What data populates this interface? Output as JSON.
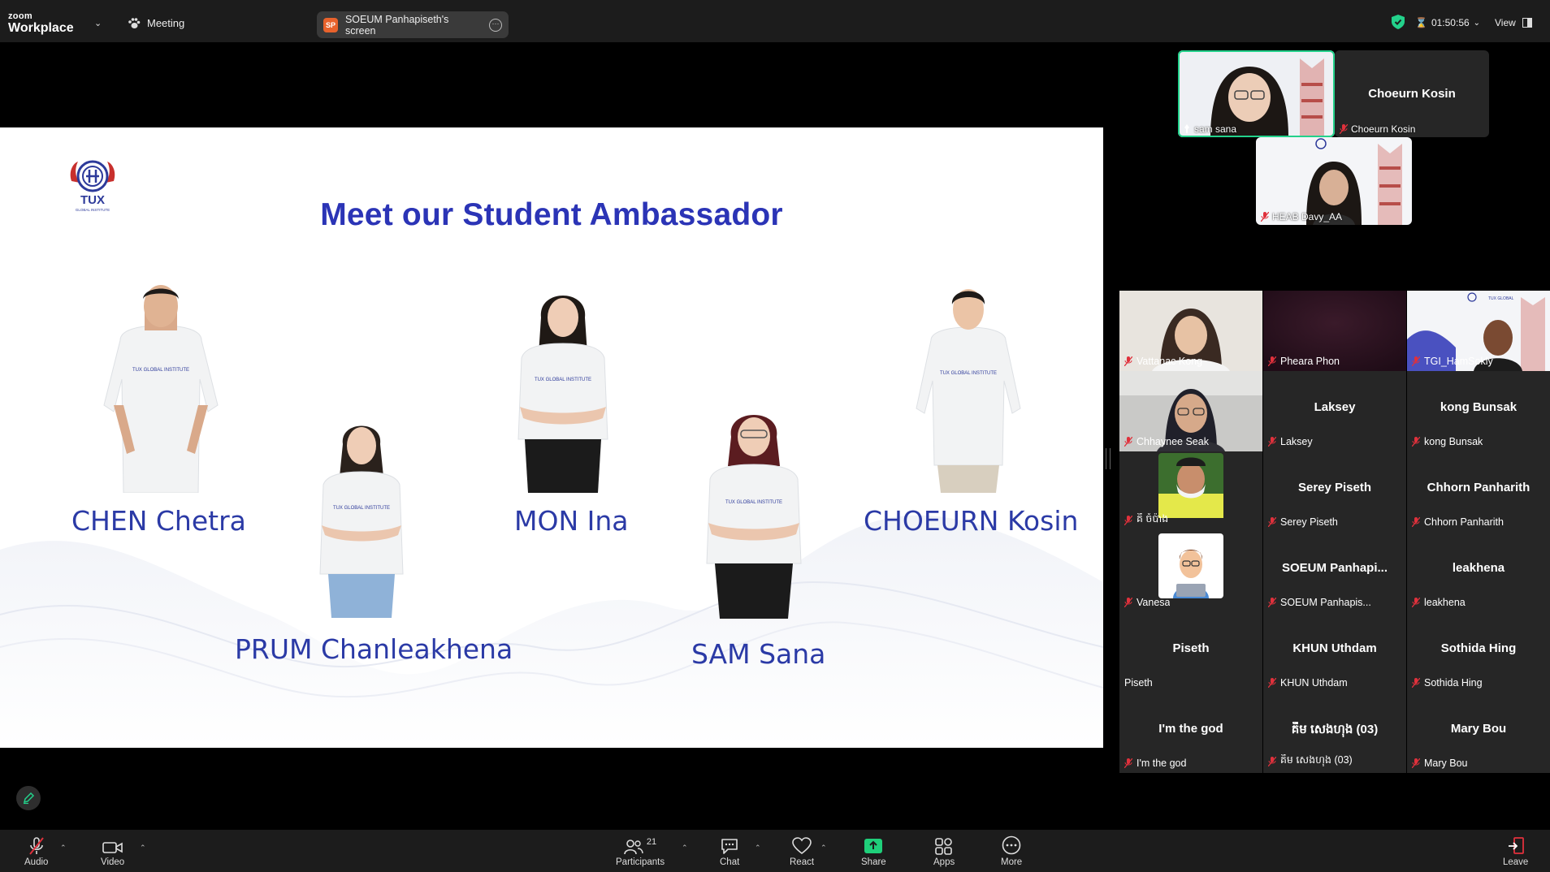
{
  "app": {
    "brand_small": "zoom",
    "brand_big": "Workplace",
    "meeting_label": "Meeting"
  },
  "share": {
    "badge": "SP",
    "label": "SOEUM Panhapiseth's screen"
  },
  "status": {
    "timer": "01:50:56",
    "view_label": "View"
  },
  "slide": {
    "logo_text": "TUX",
    "logo_sub": "GLOBAL INSTITUTE",
    "title": "Meet our Student Ambassador",
    "people": [
      {
        "name": "CHEN Chetra"
      },
      {
        "name": "PRUM Chanleakhena"
      },
      {
        "name": "MON Ina"
      },
      {
        "name": "SAM Sana"
      },
      {
        "name": "CHOEURN Kosin"
      }
    ],
    "shirt_text": "TUX GLOBAL INSTITUTE"
  },
  "top_tiles": [
    {
      "name": "sam sana",
      "video": true,
      "active": true
    },
    {
      "name": "Choeurn Kosin",
      "center": "Choeurn Kosin",
      "video": false
    },
    {
      "name": "HEAB Davy_AA",
      "video": true
    }
  ],
  "gallery": [
    {
      "name": "Vattanac Kong",
      "video": true
    },
    {
      "name": "Pheara Phon",
      "video": true
    },
    {
      "name": "TGI_HamSokly",
      "video": true
    },
    {
      "name": "Chhaynee Seak",
      "video": true
    },
    {
      "name": "Laksey",
      "center": "Laksey"
    },
    {
      "name": "kong Bunsak",
      "center": "kong Bunsak"
    },
    {
      "name": "គី ចំប៉ាង",
      "video": true
    },
    {
      "name": "Serey Piseth",
      "center": "Serey Piseth"
    },
    {
      "name": "Chhorn Panharith",
      "center": "Chhorn Panharith"
    },
    {
      "name": "Vanesa",
      "avatar": true
    },
    {
      "name": "SOEUM Panhapis...",
      "center": "SOEUM  Panhapi..."
    },
    {
      "name": "leakhena",
      "center": "leakhena"
    },
    {
      "name": "Piseth",
      "center": "Piseth",
      "unmuted": true
    },
    {
      "name": "KHUN Uthdam",
      "center": "KHUN Uthdam"
    },
    {
      "name": "Sothida Hing",
      "center": "Sothida Hing"
    },
    {
      "name": "I'm the god",
      "center": "I'm the god"
    },
    {
      "name": "គឹម សេងហុង (03)",
      "center": "គឹម សេងហុង (03)"
    },
    {
      "name": "Mary Bou",
      "center": "Mary Bou"
    }
  ],
  "toolbar": {
    "audio": "Audio",
    "video": "Video",
    "participants": "Participants",
    "participants_count": "21",
    "chat": "Chat",
    "react": "React",
    "share": "Share",
    "apps": "Apps",
    "more": "More",
    "leave": "Leave"
  },
  "colors": {
    "accent_green": "#23d18b",
    "title_blue": "#2b34b6",
    "name_blue": "#2b3aa6",
    "mute_red": "#e0313c",
    "share_green": "#1fcf7a"
  }
}
